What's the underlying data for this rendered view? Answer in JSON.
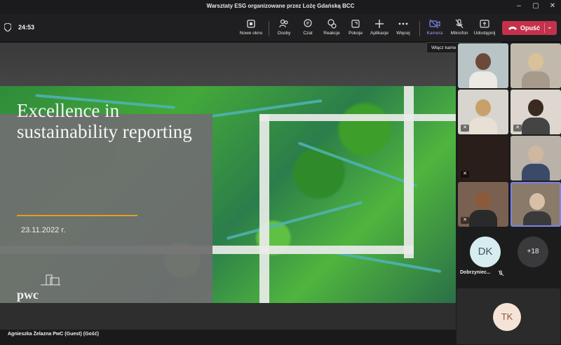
{
  "window": {
    "title": "Warsztaty ESG organizowane przez Lożę Gdańską BCC"
  },
  "toolbar": {
    "timer": "24:53",
    "buttons": [
      {
        "label": "Nowe okno",
        "icon": "new-window-icon"
      },
      {
        "label": "Osoby",
        "icon": "people-icon"
      },
      {
        "label": "Czat",
        "icon": "chat-icon"
      },
      {
        "label": "Reakcje",
        "icon": "reactions-icon"
      },
      {
        "label": "Pokoje",
        "icon": "rooms-icon"
      },
      {
        "label": "Aplikacje",
        "icon": "plus-icon"
      },
      {
        "label": "Więcej",
        "icon": "more-icon"
      },
      {
        "label": "Kamera",
        "icon": "camera-off-icon"
      },
      {
        "label": "Mikrofon",
        "icon": "mic-off-icon"
      },
      {
        "label": "Udostępnij",
        "icon": "share-icon"
      }
    ],
    "leave_label": "Opuść",
    "tooltip": "Włącz kamerę (Ctrl+Shift+O)"
  },
  "slide": {
    "title": "Excellence in sustainability reporting",
    "date": "23.11.2022 r.",
    "logo_text": "pwc"
  },
  "speaker_label": "Agnieszka Żelazna PwC (Guest) (Gość)",
  "participants": {
    "avatar_dk": {
      "initials": "DK",
      "name": "Dobrzyniec..."
    },
    "overflow": "+18",
    "avatar_tk": {
      "initials": "TK"
    }
  },
  "colors": {
    "leave": "#c4314b",
    "accent": "#6264a7",
    "rule": "#e0a020"
  }
}
